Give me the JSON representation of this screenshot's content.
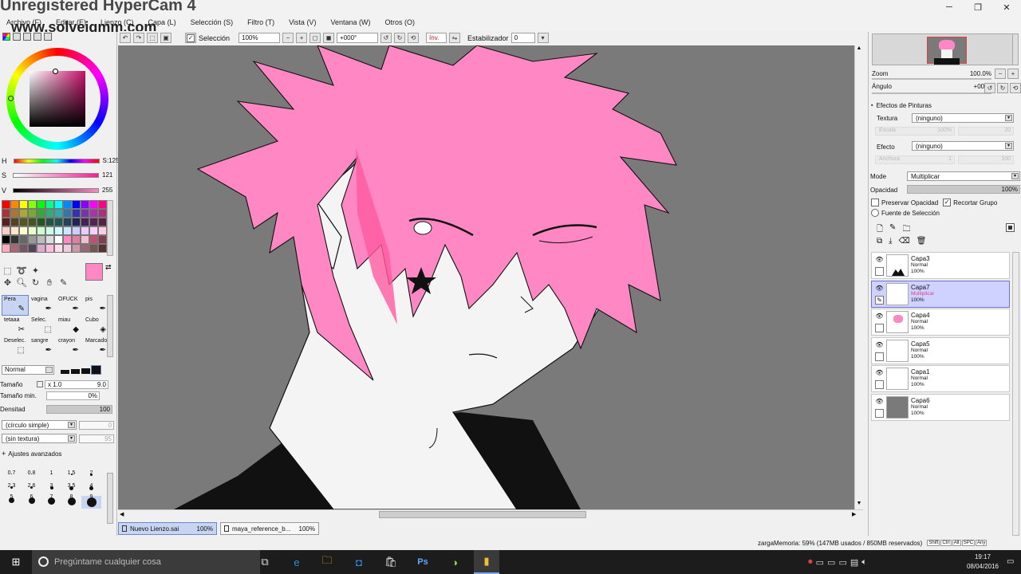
{
  "watermark": {
    "title": "Unregistered HyperCam 4",
    "site": "www.solveigmm.com"
  },
  "window": {
    "controls": [
      "─",
      "❐",
      "✕"
    ]
  },
  "menu": [
    {
      "label": "Archivo (F)"
    },
    {
      "label": "Editar (E)"
    },
    {
      "label": "Lienzo (C)"
    },
    {
      "label": "Capa (L)"
    },
    {
      "label": "Selección (S)"
    },
    {
      "label": "Filtro (T)"
    },
    {
      "label": "Vista (V)"
    },
    {
      "label": "Ventana (W)"
    },
    {
      "label": "Otros (O)"
    }
  ],
  "toolbar": {
    "selection_label": "Selección",
    "selection_checked": true,
    "zoom": "100%",
    "angle": "+000°",
    "invert_label": "Inv.",
    "stabilizer_label": "Estabilizador",
    "stabilizer_value": "0"
  },
  "color": {
    "sliders": [
      {
        "label": "H",
        "value": "S:125"
      },
      {
        "label": "S",
        "value": "121"
      },
      {
        "label": "V",
        "value": "255"
      }
    ],
    "current": "#ff88c4",
    "secondary": "#ffffff",
    "palette": [
      "#ff0000",
      "#ff8800",
      "#ffff00",
      "#88ff00",
      "#00ff00",
      "#00ff88",
      "#00ffff",
      "#0088ff",
      "#0000ff",
      "#8800ff",
      "#ff00ff",
      "#ff0088",
      "#aa3333",
      "#aa7733",
      "#aaaa33",
      "#77aa33",
      "#33aa33",
      "#33aa77",
      "#33aaaa",
      "#3377aa",
      "#3333aa",
      "#7733aa",
      "#aa33aa",
      "#aa3377",
      "#552222",
      "#554422",
      "#555522",
      "#445522",
      "#225522",
      "#225544",
      "#225555",
      "#224455",
      "#222255",
      "#442255",
      "#552255",
      "#552244",
      "#ffcccc",
      "#ffe6cc",
      "#ffffcc",
      "#e6ffcc",
      "#ccffcc",
      "#ccffe6",
      "#ccffff",
      "#cce6ff",
      "#ccccff",
      "#e6ccff",
      "#ffccff",
      "#ffcce6",
      "#000000",
      "#333333",
      "#666666",
      "#999999",
      "#bbbbbb",
      "#dddddd",
      "#ffffff",
      "#ff88c4",
      "#e080a0",
      "#f0c0d0",
      "#c05070",
      "#804050",
      "#ffaabb",
      "#aa6677",
      "#775566",
      "#554455",
      "#ddaacc",
      "#ffbbdd",
      "#ffddee",
      "#eeccdd",
      "#cc99aa",
      "#996677",
      "#775555",
      "#553333"
    ]
  },
  "brushes": [
    {
      "label": "Pera",
      "icon": "✎",
      "selected": true
    },
    {
      "label": "vagina",
      "icon": "✒"
    },
    {
      "label": "OFUCK",
      "icon": "✒"
    },
    {
      "label": "pis",
      "icon": "✒"
    },
    {
      "label": "tetaaa",
      "icon": "✂"
    },
    {
      "label": "Selec.",
      "icon": "⬚"
    },
    {
      "label": "miau",
      "icon": "◆"
    },
    {
      "label": "Cubo",
      "icon": "◈"
    },
    {
      "label": "Deselec.",
      "icon": "⬚"
    },
    {
      "label": "sangre",
      "icon": "✒"
    },
    {
      "label": "crayon",
      "icon": "✒"
    },
    {
      "label": "Marcado",
      "icon": "✒"
    }
  ],
  "brush_props": {
    "blend": "Normal",
    "size_label": "Tamaño",
    "size_mult": "x 1.0",
    "size_value": "9.0",
    "min_size_label": "Tamaño min.",
    "min_size_value": "0%",
    "density_label": "Densitad",
    "density_value": "100",
    "shape": "(círculo simple)",
    "shape_value": "0",
    "texture": "(sin textura)",
    "texture_value": "95",
    "advanced_label": "Ajustes avanzados"
  },
  "dot_sizes": [
    "0.7",
    "0.8",
    "1",
    "1.5",
    "2",
    "2.3",
    "2.6",
    "3",
    "3.5",
    "4",
    "5",
    "6",
    "7",
    "8",
    "9"
  ],
  "doc_tabs": [
    {
      "name": "Nuevo Lienzo.sai",
      "zoom": "100%",
      "active": true
    },
    {
      "name": "maya_reference_b...",
      "zoom": "100%",
      "active": false
    }
  ],
  "navigator": {
    "zoom_label": "Zoom",
    "zoom_value": "100.0%",
    "angle_label": "Ángulo",
    "angle_value": "+0005"
  },
  "effects": {
    "title": "Efectos de Pinturas",
    "texture_label": "Textura",
    "texture_value": "(ninguno)",
    "texture_sub_label": "Escala",
    "texture_sub_value": "100%",
    "texture_sub_value2": "20",
    "effect_label": "Efecto",
    "effect_value": "(ninguno)",
    "effect_sub_label": "Anchura",
    "effect_sub_value": "1",
    "effect_sub_value2": "100"
  },
  "layer_props": {
    "mode_label": "Mode",
    "mode_value": "Multiplicar",
    "opacity_label": "Opacidad",
    "opacity_value": "100%",
    "preserve_label": "Preservar Opacidad",
    "clip_label": "Recortar Grupo",
    "source_label": "Fuente de Selección"
  },
  "layers": [
    {
      "name": "Capa3",
      "mode": "Normal",
      "opacity": "100%",
      "selected": false
    },
    {
      "name": "Capa7",
      "mode": "Multiplicar",
      "opacity": "100%",
      "selected": true
    },
    {
      "name": "Capa4",
      "mode": "Normal",
      "opacity": "100%",
      "selected": false
    },
    {
      "name": "Capa5",
      "mode": "Normal",
      "opacity": "100%",
      "selected": false
    },
    {
      "name": "Capa1",
      "mode": "Normal",
      "opacity": "100%",
      "selected": false
    },
    {
      "name": "Capa6",
      "mode": "Normal",
      "opacity": "100%",
      "selected": false
    }
  ],
  "status": {
    "memory": "zargaMemoria: 59% (147MB usados / 850MB reservados)",
    "keys": [
      "Shift",
      "Ctrl",
      "Alt",
      "SPC",
      "Any"
    ]
  },
  "taskbar": {
    "search_placeholder": "Pregúntame cualquier cosa",
    "time": "19:17",
    "date": "08/04/2016"
  }
}
